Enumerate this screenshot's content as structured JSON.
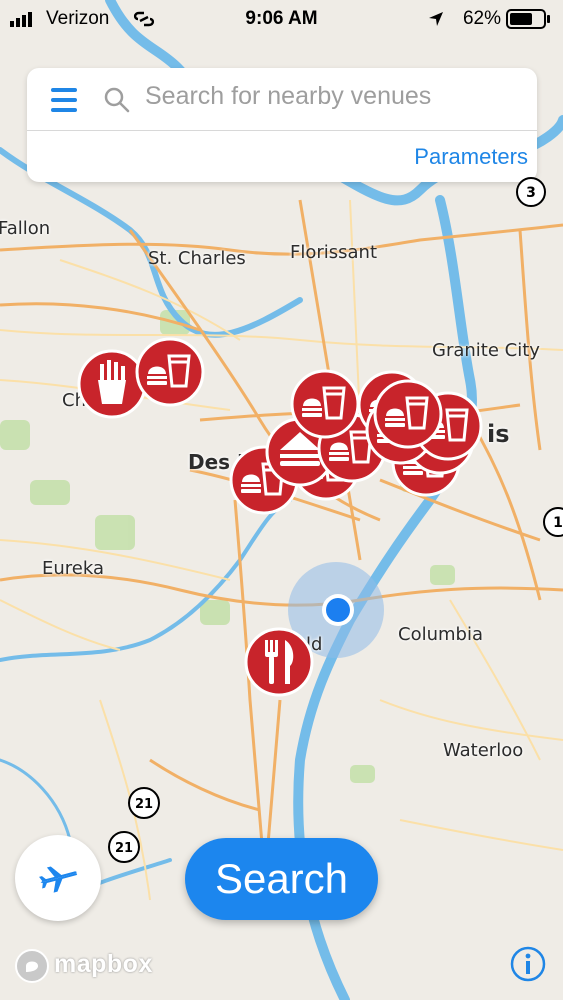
{
  "status_bar": {
    "carrier": "Verizon",
    "time": "9:06 AM",
    "battery_percent": "62%"
  },
  "search": {
    "placeholder": "Search for nearby venues",
    "parameters_label": "Parameters"
  },
  "map_labels": {
    "fallon": "Fallon",
    "st_charles": "St. Charles",
    "florissant": "Florissant",
    "granite_city": "Granite City",
    "des_peres": "Des P",
    "is": "is",
    "eureka": "Eureka",
    "columbia": "Columbia",
    "waterloo": "Waterloo",
    "ld": "ld",
    "ch": "Ch"
  },
  "shields": {
    "hwy3": "3",
    "hwy1": "1",
    "hwy21_top": "21",
    "hwy21_bottom": "21"
  },
  "search_button": "Search",
  "attribution": "mapbox",
  "icons": {
    "menu": "hamburger-menu-icon",
    "search": "magnifier-icon",
    "plane": "airplane-icon",
    "info": "info-icon",
    "pin_fries": "fries-icon",
    "pin_fastfood": "burger-drink-icon",
    "pin_restaurant": "fork-knife-icon",
    "user_location": "location-dot-icon"
  },
  "colors": {
    "accent": "#1f86e6",
    "pin_red": "#c8242b",
    "map_bg": "#efece6",
    "road_orange": "#f0b26a",
    "water_blue": "#6fb8e8",
    "park_green": "#b9dca0"
  }
}
